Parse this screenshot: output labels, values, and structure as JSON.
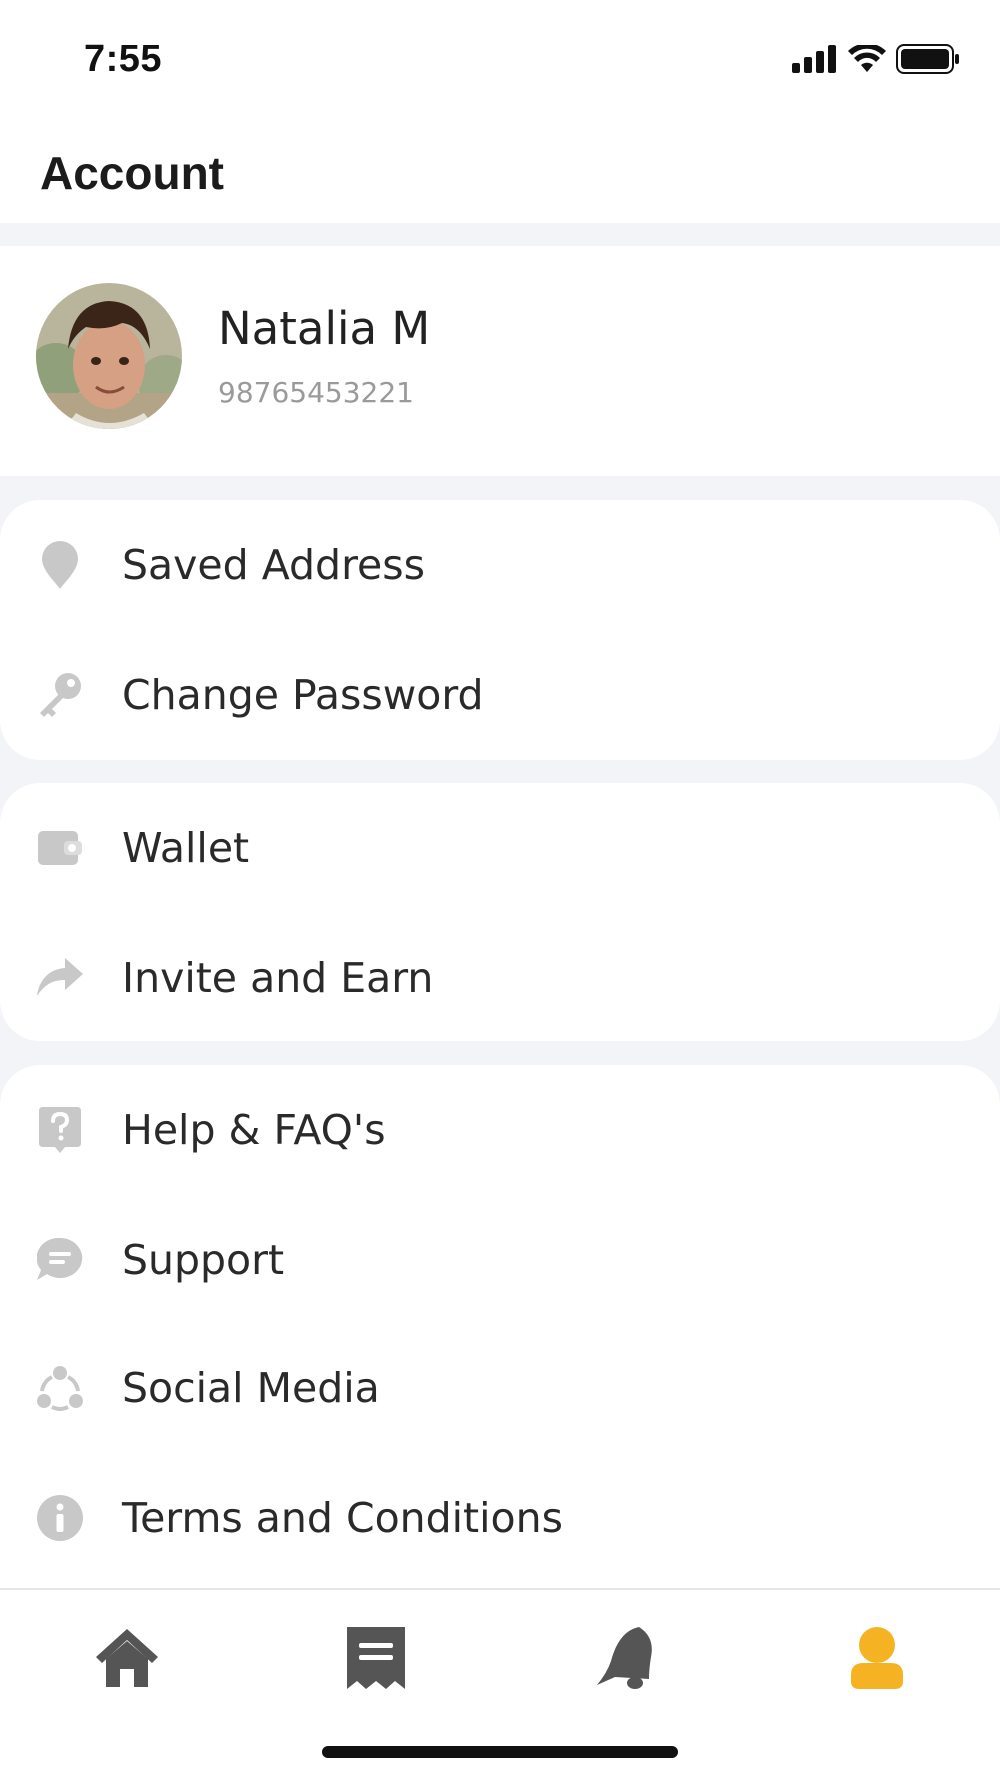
{
  "status_bar": {
    "time": "7:55"
  },
  "header": {
    "title": "Account"
  },
  "profile": {
    "name": "Natalia M",
    "phone": "98765453221"
  },
  "menu_groups": [
    {
      "items": [
        {
          "label": "Saved Address",
          "icon": "location-pin-icon"
        },
        {
          "label": "Change Password",
          "icon": "key-icon"
        }
      ]
    },
    {
      "items": [
        {
          "label": "Wallet",
          "icon": "wallet-icon"
        },
        {
          "label": "Invite and Earn",
          "icon": "share-arrow-icon"
        }
      ]
    },
    {
      "items": [
        {
          "label": "Help & FAQ's",
          "icon": "help-icon"
        },
        {
          "label": "Support",
          "icon": "chat-icon"
        },
        {
          "label": "Social Media",
          "icon": "social-network-icon"
        },
        {
          "label": "Terms and Conditions",
          "icon": "info-icon"
        }
      ]
    }
  ],
  "bottom_nav": [
    {
      "icon": "home-icon",
      "active": false
    },
    {
      "icon": "receipt-icon",
      "active": false
    },
    {
      "icon": "bell-icon",
      "active": false
    },
    {
      "icon": "profile-icon",
      "active": true
    }
  ],
  "colors": {
    "accent": "#f5b324",
    "icon_gray": "#c4c4c4",
    "nav_gray": "#555555",
    "background": "#f3f4f7"
  }
}
